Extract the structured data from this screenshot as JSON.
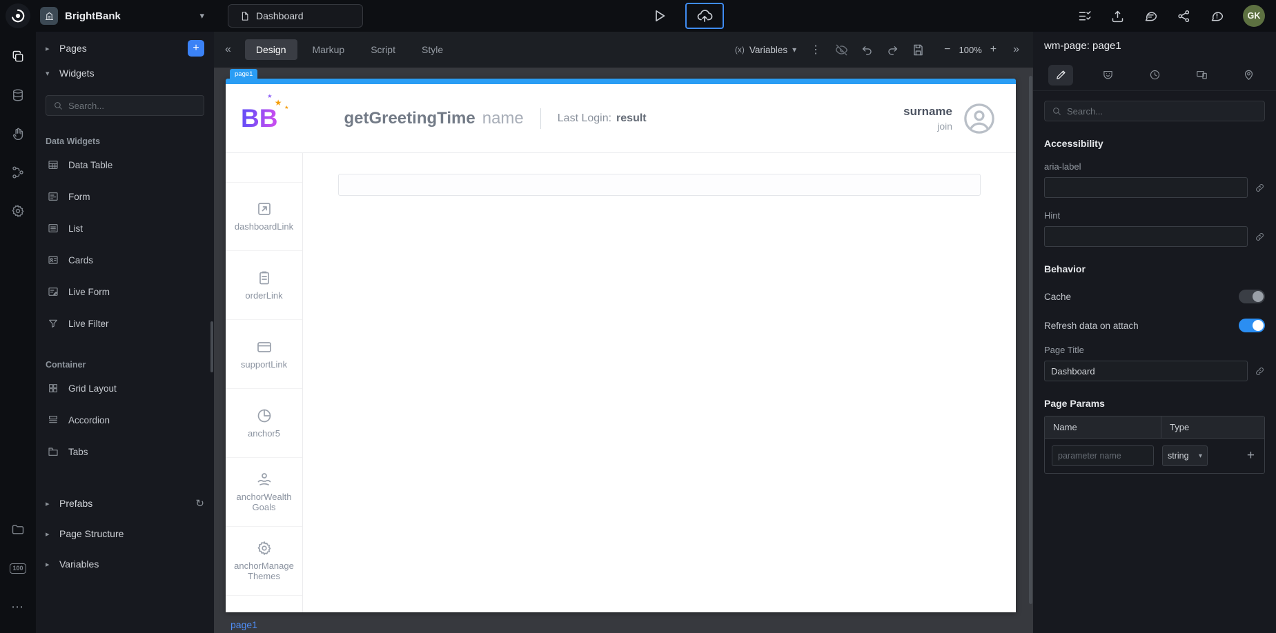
{
  "icons": {
    "caret_right": "▸",
    "caret_down": "▾",
    "chevron_down": "▾",
    "chevrons_left": "«",
    "chevrons_right": "»",
    "kebab": "⋮",
    "dots": "⋯",
    "plus": "+",
    "minus": "−",
    "variables_glyph": "(x)",
    "refresh": "↻",
    "hundred": "100",
    "star": "★",
    "pipe": "|"
  },
  "topbar": {
    "project_name": "BrightBank",
    "page_tab_label": "Dashboard",
    "avatar_initials": "GK"
  },
  "left_panel": {
    "pages_label": "Pages",
    "widgets_label": "Widgets",
    "search_placeholder": "Search...",
    "data_widgets_title": "Data Widgets",
    "data_widgets_items": [
      "Data Table",
      "Form",
      "List",
      "Cards",
      "Live Form",
      "Live Filter"
    ],
    "container_title": "Container",
    "container_items": [
      "Grid Layout",
      "Accordion",
      "Tabs"
    ],
    "collapsed": [
      "Prefabs",
      "Page Structure",
      "Variables"
    ]
  },
  "canvas_toolbar": {
    "tabs": [
      "Design",
      "Markup",
      "Script",
      "Style"
    ],
    "active_tab": "Design",
    "variables_label": "Variables",
    "zoom_level": "100%"
  },
  "canvas": {
    "page_tag": "page1",
    "page_footer_label": "page1",
    "header": {
      "logo_text": "BB",
      "greeting_fn": "getGreetingTime",
      "greeting_arg": "name",
      "last_login_label": "Last Login:",
      "last_login_value": "result",
      "surname": "surname",
      "join": "join"
    },
    "nav_items": [
      "dashboardLink",
      "orderLink",
      "supportLink",
      "anchor5",
      "anchorWealthGoals",
      "anchorManageThemes"
    ]
  },
  "right_panel": {
    "title": "wm-page: page1",
    "search_placeholder": "Search...",
    "accessibility_title": "Accessibility",
    "aria_label": "aria-label",
    "hint_label": "Hint",
    "behavior_title": "Behavior",
    "cache_label": "Cache",
    "cache_on": false,
    "refresh_label": "Refresh data on attach",
    "refresh_on": true,
    "page_title_label": "Page Title",
    "page_title_value": "Dashboard",
    "page_params_title": "Page Params",
    "col_name": "Name",
    "col_type": "Type",
    "param_placeholder": "parameter name",
    "type_value": "string"
  },
  "colors": {
    "accent_blue": "#3f8cf3",
    "toggle_on": "#2b8ef2",
    "page_select_blue": "#2a9df4",
    "avatar_green": "#5d7141",
    "add_button_blue": "#3b82f6"
  }
}
